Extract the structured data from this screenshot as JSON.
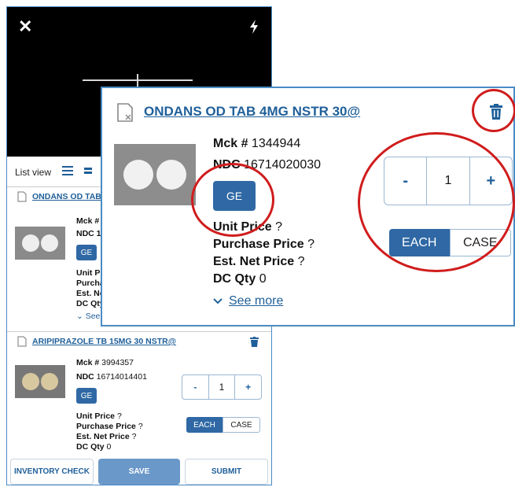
{
  "camera": {
    "close_glyph": "✕"
  },
  "list_toolbar": {
    "label": "List view"
  },
  "items": [
    {
      "title": "ONDANS OD TAB",
      "mck_label": "Mck #",
      "ndc_label": "NDC 1",
      "ge_label": "GE",
      "unit_price": "Unit P",
      "purchase_price": "Purcha",
      "est_net_price": "Est. Ne",
      "dc_qty": "DC Qty",
      "see_more": "See"
    },
    {
      "title": "ARIPIPRAZOLE TB 15MG 30 NSTR@",
      "mck_label": "Mck #",
      "mck_value": "3994357",
      "ndc_label": "NDC",
      "ndc_value": "16714014401",
      "ge_label": "GE",
      "unit_price_label": "Unit Price",
      "purchase_price_label": "Purchase Price",
      "est_net_price_label": "Est. Net Price",
      "price_value": "?",
      "dc_qty_label": "DC Qty",
      "dc_qty_value": "0",
      "qty": "1",
      "unit_on": "EACH",
      "unit_off": "CASE"
    }
  ],
  "footer": {
    "inventory_check": "INVENTORY CHECK",
    "save": "SAVE",
    "submit": "SUBMIT"
  },
  "popup": {
    "title": "ONDANS OD TAB 4MG NSTR 30@",
    "mck_label": "Mck #",
    "mck_value": "1344944",
    "ndc_label": "NDC",
    "ndc_value": "16714020030",
    "ge_label": "GE",
    "unit_price_label": "Unit Price",
    "purchase_price_label": "Purchase Price",
    "est_net_price_label": "Est. Net Price",
    "price_value": "?",
    "dc_qty_label": "DC Qty",
    "dc_qty_value": "0",
    "see_more": "See more",
    "minus": "-",
    "qty": "1",
    "plus": "+",
    "unit_on": "EACH",
    "unit_off": "CASE"
  },
  "colors": {
    "accent": "#1f5f99",
    "button_fill": "#2f68a4",
    "highlight_ring": "#d01c1c"
  }
}
